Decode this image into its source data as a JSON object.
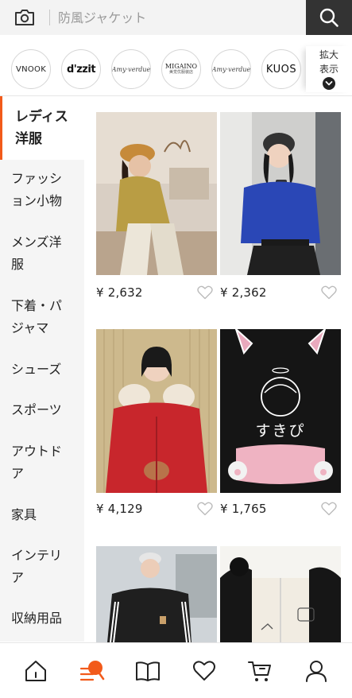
{
  "search": {
    "placeholder": "防風ジャケット"
  },
  "brands": {
    "vnook": "VNOOK",
    "dzzit": "d'zzit",
    "amy1": "Amy·verdue",
    "migaino": "MIGAINO",
    "migaino_sub": "美觉优服装店",
    "amy2": "Amy·verdue",
    "kuos": "KUOS",
    "expand_label": "拡大表示"
  },
  "sidebar": {
    "items": [
      {
        "label": "レディス洋服"
      },
      {
        "label": "ファッション小物"
      },
      {
        "label": "メンズ洋服"
      },
      {
        "label": "下着・パジャマ"
      },
      {
        "label": "シューズ"
      },
      {
        "label": "スポーツ"
      },
      {
        "label": "アウトドア"
      },
      {
        "label": "家具"
      },
      {
        "label": "インテリア"
      },
      {
        "label": "収納用品"
      }
    ]
  },
  "products": [
    {
      "price": "¥ 2,632"
    },
    {
      "price": "¥ 2,362"
    },
    {
      "price": "¥ 4,129"
    },
    {
      "price": "¥ 1,765"
    }
  ],
  "product_texts": {
    "hoodie_print": "すきぴ"
  },
  "colors": {
    "accent": "#f25a1a",
    "search_button": "#333333",
    "sidebar_bg": "#f5f5f5"
  },
  "tabs": [
    {
      "icon": "home-icon"
    },
    {
      "icon": "category-icon"
    },
    {
      "icon": "book-icon"
    },
    {
      "icon": "heart-icon"
    },
    {
      "icon": "cart-icon"
    },
    {
      "icon": "user-icon"
    }
  ]
}
